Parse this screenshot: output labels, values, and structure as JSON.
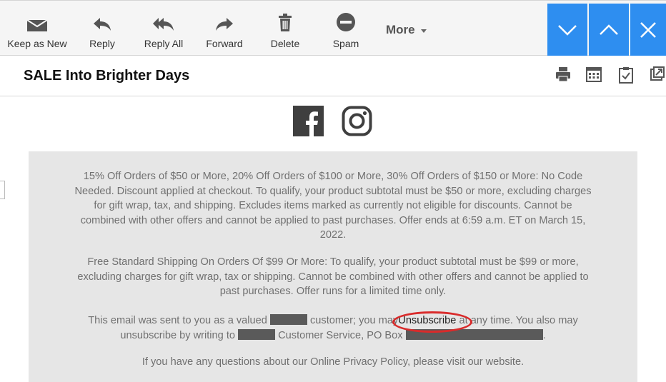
{
  "toolbar": {
    "keep_as_new": "Keep as New",
    "reply": "Reply",
    "reply_all": "Reply All",
    "forward": "Forward",
    "delete": "Delete",
    "spam": "Spam",
    "more": "More"
  },
  "subject": "SALE Into Brighter Days",
  "email_body": {
    "p1": "15% Off Orders of $50 or More, 20% Off Orders of $100 or More, 30% Off Orders of $150 or More: No Code Needed. Discount applied at checkout. To qualify, your product subtotal must be $50 or more, excluding charges for gift wrap, tax, and shipping. Excludes items marked as currently not eligible for discounts. Cannot be combined with other offers and cannot be applied to past purchases. Offer ends at 6:59 a.m. ET on March 15, 2022.",
    "p2": "Free Standard Shipping On Orders Of $99 Or More: To qualify, your product subtotal must be $99 or more, excluding charges for gift wrap, tax or shipping. Cannot be combined with other offers and cannot be applied to past purchases. Offer runs for a limited time only.",
    "p3_a": "This email was sent to you as a valued",
    "p3_b": "customer; you may",
    "unsubscribe": "Unsubscribe",
    "p3_c": "at any time. You also may unsubscribe by writing to",
    "p3_d": "Customer Service, PO Box",
    "p4": "If you have any questions about our Online Privacy Policy, please visit our website."
  },
  "colors": {
    "accent": "#2e8ef0",
    "highlight_circle": "#d92b2b",
    "body_text": "#707070"
  }
}
